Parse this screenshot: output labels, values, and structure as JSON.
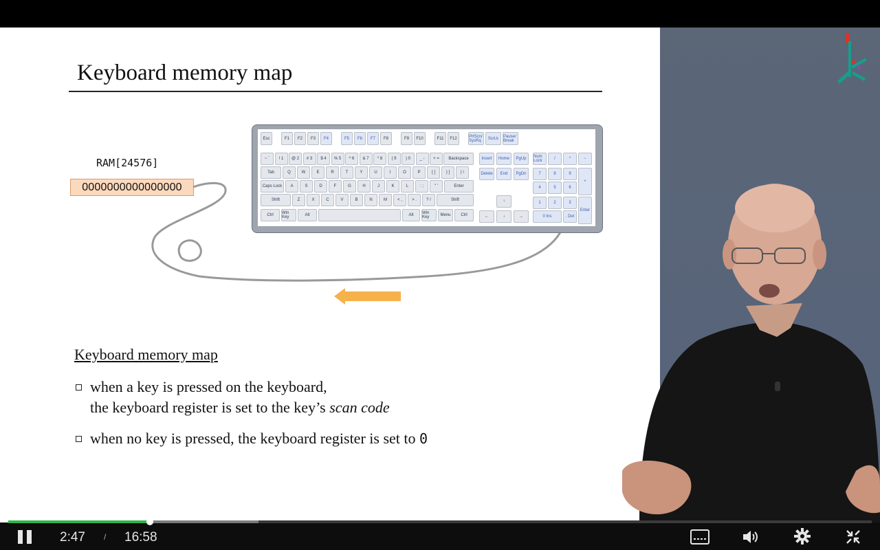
{
  "slide": {
    "title": "Keyboard memory map",
    "ram_label": "RAM[24576]",
    "ram_value": "0000000000000000",
    "subheading": "Keyboard memory map",
    "bullets": [
      {
        "line1": "when a key is pressed on the keyboard,",
        "line2_pre": "the keyboard register is set to the key’s ",
        "line2_italic": "scan code"
      },
      {
        "line1_pre": "when no key is pressed, the keyboard register is set to ",
        "line1_code": "0"
      }
    ]
  },
  "keyboard": {
    "row0": [
      "Esc",
      "F1",
      "F2",
      "F3",
      "F4",
      "F5",
      "F6",
      "F7",
      "F8",
      "F9",
      "F10",
      "F11",
      "F12",
      "PrtScn/ SysRq",
      "ScrLk",
      "Pause/ Break"
    ],
    "row1": [
      "~ `",
      "! 1",
      "@ 2",
      "# 3",
      "$ 4",
      "% 5",
      "^ 6",
      "& 7",
      "* 8",
      "( 9",
      ") 0",
      "_ -",
      "+ =",
      "Backspace"
    ],
    "row2": [
      "Tab",
      "Q",
      "W",
      "E",
      "R",
      "T",
      "Y",
      "U",
      "I",
      "O",
      "P",
      "{ [",
      "} ]",
      "| \\"
    ],
    "row3": [
      "Caps Lock",
      "A",
      "S",
      "D",
      "F",
      "G",
      "H",
      "J",
      "K",
      "L",
      ": ;",
      "\" '",
      "Enter"
    ],
    "row4": [
      "Shift",
      "Z",
      "X",
      "C",
      "V",
      "B",
      "N",
      "M",
      "< ,",
      "> .",
      "? /",
      "Shift"
    ],
    "row5": [
      "Ctrl",
      "Win Key",
      "Alt",
      "",
      "Alt",
      "Win Key",
      "Menu",
      "Ctrl"
    ],
    "nav": [
      "Insert",
      "Home",
      "PgUp",
      "Delete",
      "End",
      "PgDn"
    ],
    "arrows": [
      "↑",
      "←",
      "↓",
      "→"
    ],
    "numpad": [
      "Num Lock",
      "/",
      "*",
      "−",
      "7",
      "8",
      "9",
      "+",
      "4",
      "5",
      "6",
      "1",
      "2",
      "3",
      "Enter",
      "0 Ins",
      ". Del"
    ]
  },
  "player": {
    "current_time": "2:47",
    "separator": "/",
    "duration": "16:58",
    "progress": 0.164,
    "buffered": 0.29,
    "accent_color": "#2fb54a"
  },
  "icons": {
    "play_pause": "pause-icon",
    "captions": "captions-icon",
    "volume": "volume-icon",
    "settings": "gear-icon",
    "fullscreen": "exit-fullscreen-icon"
  }
}
